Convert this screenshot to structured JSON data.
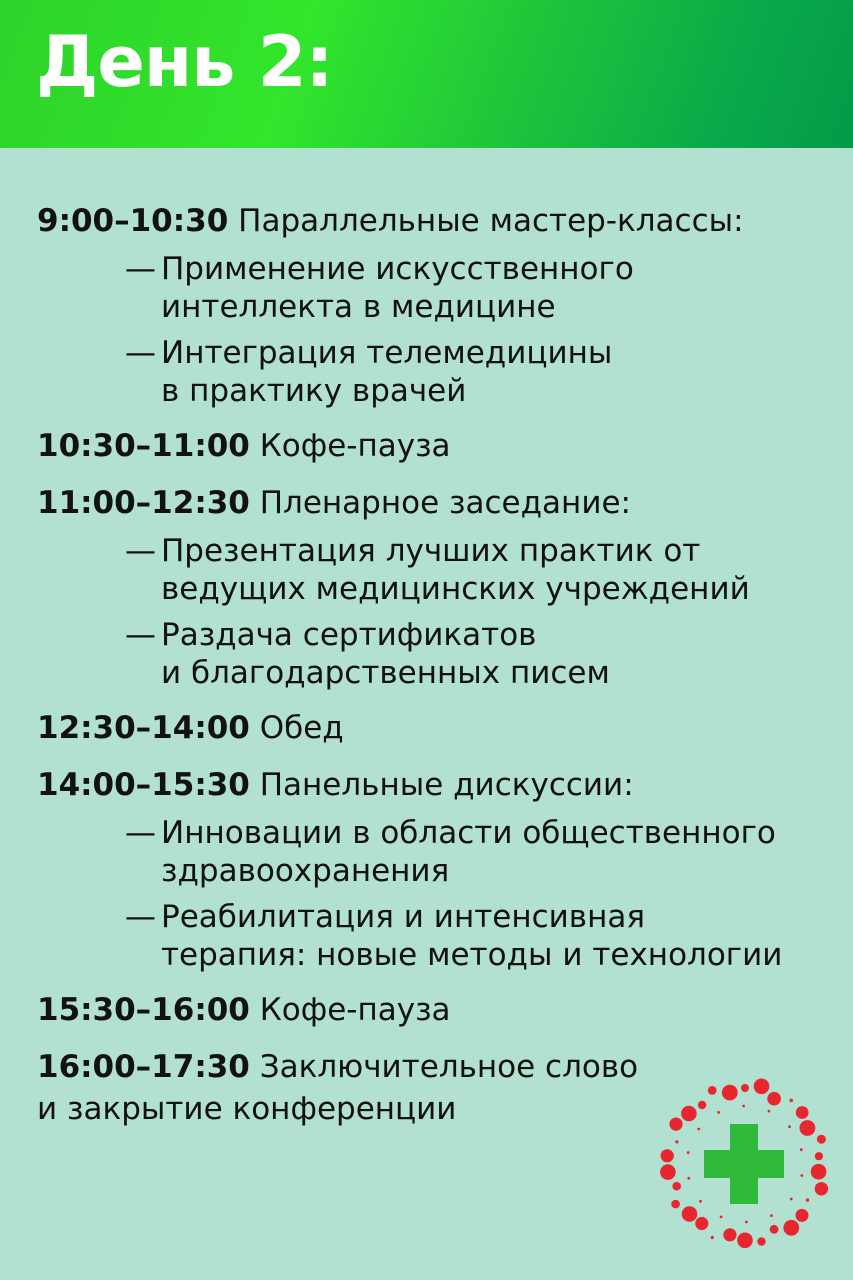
{
  "header": {
    "title": "День 2:"
  },
  "schedule": [
    {
      "time": "9:00–10:30",
      "text": "Параллельные мастер-классы:",
      "items": [
        {
          "lines": [
            "Применение искусственного",
            "интеллекта в медицине"
          ]
        },
        {
          "lines": [
            "Интеграция телемедицины",
            "в практику врачей"
          ]
        }
      ]
    },
    {
      "time": "10:30–11:00",
      "text": "Кофе-пауза",
      "items": []
    },
    {
      "time": "11:00–12:30",
      "text": "Пленарное заседание:",
      "items": [
        {
          "lines": [
            "Презентация лучших практик от",
            "ведущих медицинских учреждений"
          ]
        },
        {
          "lines": [
            "Раздача сертификатов",
            "и благодарственных писем"
          ]
        }
      ]
    },
    {
      "time": "12:30–14:00",
      "text": "Обед",
      "items": []
    },
    {
      "time": "14:00–15:30",
      "text": "Панельные дискуссии:",
      "items": [
        {
          "lines": [
            "Инновации в области общественного",
            "здравоохранения"
          ]
        },
        {
          "lines": [
            "Реабилитация и интенсивная",
            "терапия: новые методы и технологии"
          ]
        }
      ]
    },
    {
      "time": "15:30–16:00",
      "text": "Кофе-пауза",
      "items": []
    },
    {
      "time": "16:00–17:30",
      "text": "Заключительное слово",
      "continuation": "и закрытие конференции",
      "items": []
    }
  ],
  "bullet": "—",
  "logo": {
    "icon": "medical-cross-logo-icon",
    "cross_color": "#2fba3a",
    "dot_color": "#e8262f"
  },
  "colors": {
    "background": "#b3e1d1",
    "header_from": "#33e52c",
    "header_to": "#039a48",
    "title": "#ffffff",
    "text": "#121212"
  }
}
